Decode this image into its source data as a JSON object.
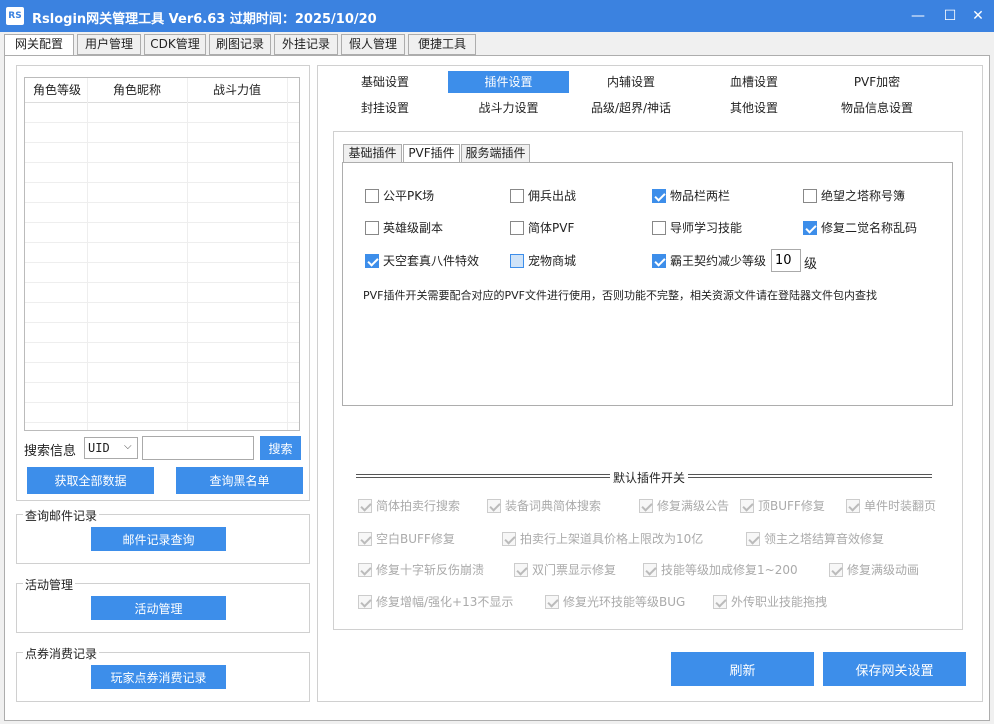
{
  "window": {
    "icon_text": "RS",
    "title": "Rslogin网关管理工具  Ver6.63  过期时间：2025/10/20",
    "minimize": "—",
    "maximize": "☐",
    "close": "✕"
  },
  "main_tabs": [
    "网关配置",
    "用户管理",
    "CDK管理",
    "刷图记录",
    "外挂记录",
    "假人管理",
    "便捷工具"
  ],
  "grid": {
    "columns": [
      "角色等级",
      "角色昵称",
      "战斗力值"
    ]
  },
  "search": {
    "label": "搜索信息",
    "select_value": "UID",
    "input_value": "",
    "button": "搜索"
  },
  "left_buttons": {
    "get_all": "获取全部数据",
    "blacklist": "查询黑名单"
  },
  "mail_group": {
    "title": "查询邮件记录",
    "button": "邮件记录查询"
  },
  "activity_group": {
    "title": "活动管理",
    "button": "活动管理"
  },
  "points_group": {
    "title": "点券消费记录",
    "button": "玩家点券消费记录"
  },
  "setting_tabs": {
    "row1": [
      "基础设置",
      "插件设置",
      "内辅设置",
      "血槽设置",
      "PVF加密"
    ],
    "row2": [
      "封挂设置",
      "战斗力设置",
      "品级/超界/神话",
      "其他设置",
      "物品信息设置"
    ]
  },
  "plugin_tabs": [
    "基础插件",
    "PVF插件",
    "服务端插件"
  ],
  "pvf": {
    "items": [
      {
        "label": "公平PK场",
        "checked": false
      },
      {
        "label": "佣兵出战",
        "checked": false
      },
      {
        "label": "物品栏两栏",
        "checked": true
      },
      {
        "label": "绝望之塔称号簿",
        "checked": false
      },
      {
        "label": "英雄级副本",
        "checked": false
      },
      {
        "label": "简体PVF",
        "checked": false
      },
      {
        "label": "导师学习技能",
        "checked": false
      },
      {
        "label": "修复二觉名称乱码",
        "checked": true
      },
      {
        "label": "天空套真八件特效",
        "checked": true
      },
      {
        "label": "宠物商城",
        "checked": false
      },
      {
        "label": "霸王契约减少等级",
        "checked": true
      }
    ],
    "level_value": "10",
    "level_unit": "级",
    "note": "PVF插件开关需要配合对应的PVF文件进行使用，否则功能不完整，相关资源文件请在登陆器文件包内查找"
  },
  "defaults": {
    "title": "默认插件开关",
    "items": [
      "简体拍卖行搜索",
      "装备词典简体搜索",
      "修复满级公告",
      "顶BUFF修复",
      "单件时装翻页",
      "空白BUFF修复",
      "拍卖行上架道具价格上限改为10亿",
      "领主之塔结算音效修复",
      "修复十字斩反伤崩溃",
      "双门票显示修复",
      "技能等级加成修复1~200",
      "修复满级动画",
      "修复增幅/强化+13不显示",
      "修复光环技能等级BUG",
      "外传职业技能拖拽"
    ]
  },
  "bottom_buttons": {
    "refresh": "刷新",
    "save": "保存网关设置"
  }
}
